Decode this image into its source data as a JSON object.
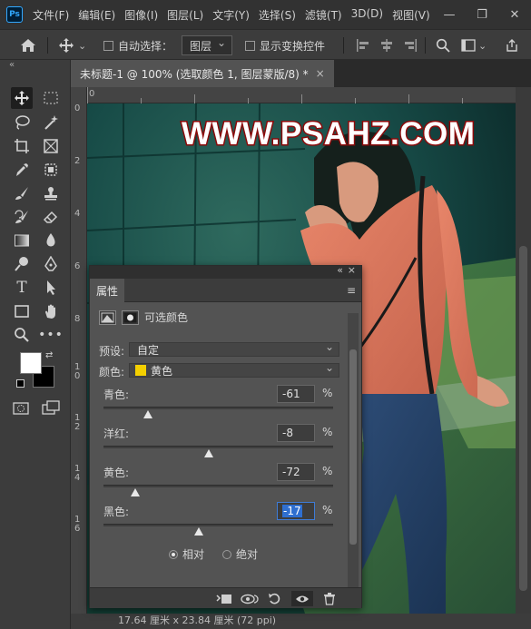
{
  "app": {
    "logo": "Ps"
  },
  "menu": [
    "文件(F)",
    "编辑(E)",
    "图像(I)",
    "图层(L)",
    "文字(Y)",
    "选择(S)",
    "滤镜(T)",
    "3D(D)",
    "视图(V)"
  ],
  "window_controls": {
    "minimize": "—",
    "restore": "❐",
    "close": "✕"
  },
  "options_bar": {
    "auto_select_label": "自动选择：",
    "auto_select_checked": false,
    "auto_select_target": "图层",
    "show_transform_label": "显示变换控件",
    "show_transform_checked": false
  },
  "document": {
    "tab_title": "未标题-1 @ 100% (选取颜色 1, 图层蒙版/8) *",
    "close_glyph": "×",
    "status": "17.64 厘米 x 23.84 厘米 (72 ppi)",
    "watermark": "WWW.PSAHZ.COM"
  },
  "ruler": {
    "top_origin": "0",
    "left_marks": [
      "0",
      "2",
      "4",
      "6",
      "8",
      "1\n0",
      "1\n2",
      "1\n4",
      "1\n6"
    ]
  },
  "properties": {
    "tab_label": "属性",
    "panel_title": "可选颜色",
    "preset_label": "预设:",
    "preset_value": "自定",
    "colors_label": "颜色:",
    "colors_value": "黄色",
    "colors_swatch": "#f4d000",
    "sliders": [
      {
        "label": "青色:",
        "value": "-61",
        "unit": "%",
        "percent": -61
      },
      {
        "label": "洋红:",
        "value": "-8",
        "unit": "%",
        "percent": -8
      },
      {
        "label": "黄色:",
        "value": "-72",
        "unit": "%",
        "percent": -72
      },
      {
        "label": "黑色:",
        "value": "-17",
        "unit": "%",
        "percent": -17
      }
    ],
    "method": {
      "relative_label": "相对",
      "absolute_label": "绝对",
      "selected": "relative"
    }
  },
  "colors": {
    "accent": "#3e7bd6",
    "foreground": "#ffffff",
    "background": "#000000",
    "watermark_text": "#ffffff",
    "watermark_outline": "#8b0a0a"
  },
  "icons": {
    "tools": [
      "move-icon",
      "marquee-icon",
      "lasso-icon",
      "magic-wand-icon",
      "crop-icon",
      "frame-icon",
      "eyedropper-icon",
      "patch-icon",
      "brush-icon",
      "stamp-icon",
      "history-brush-icon",
      "eraser-icon",
      "gradient-icon",
      "blur-icon",
      "dodge-icon",
      "pen-icon",
      "type-icon",
      "path-select-icon",
      "rectangle-icon",
      "hand-icon",
      "zoom-icon",
      "more-icon"
    ]
  }
}
